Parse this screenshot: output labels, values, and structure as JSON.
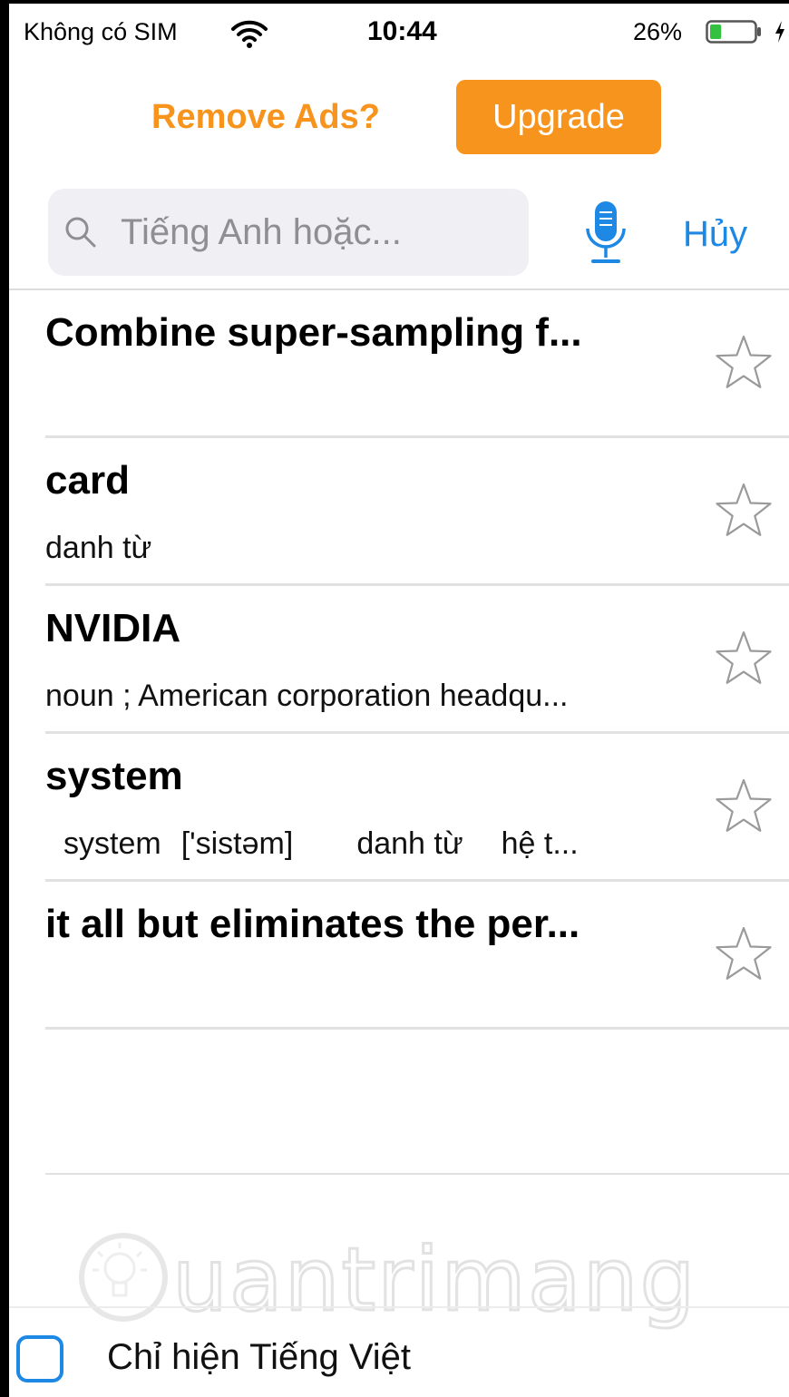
{
  "status_bar": {
    "carrier": "Không có SIM",
    "time": "10:44",
    "battery_percent": "26%",
    "battery_level": 0.26,
    "icons": [
      "wifi-icon",
      "battery-icon",
      "charging-bolt-icon"
    ]
  },
  "ads": {
    "prompt": "Remove Ads?",
    "upgrade_label": "Upgrade",
    "accent_color": "#f7941d"
  },
  "search": {
    "placeholder": "Tiếng Anh hoặc...",
    "value": "",
    "cancel_label": "Hủy",
    "icons": [
      "search-icon",
      "microphone-icon"
    ],
    "link_color": "#1e88e5"
  },
  "results": [
    {
      "title": "Combine super-sampling f...",
      "subtitle": "",
      "starred": false
    },
    {
      "title": "card",
      "subtitle": "danh từ",
      "starred": false
    },
    {
      "title": "NVIDIA",
      "subtitle": "noun ; American corporation headqu...",
      "starred": false
    },
    {
      "title": "system",
      "subtitle_parts": [
        "system",
        "['sistəm]",
        "danh từ",
        "hệ t..."
      ],
      "starred": false
    },
    {
      "title": "it all but eliminates the per...",
      "subtitle": "",
      "starred": false
    }
  ],
  "option": {
    "label": "Chỉ hiện Tiếng Việt",
    "checked": false
  },
  "watermark": {
    "text": "Quantrimang",
    "icon": "lightbulb-icon"
  }
}
